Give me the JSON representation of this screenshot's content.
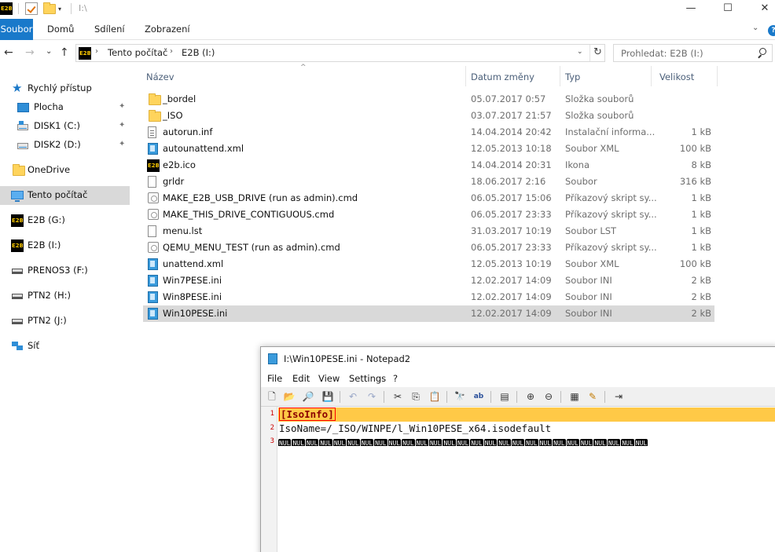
{
  "title": {
    "path": "I:\\",
    "minimize": "—",
    "maximize": "☐",
    "close": "✕",
    "qa_icon_text": "E2B"
  },
  "ribbon": {
    "tabs": [
      "Soubor",
      "Domů",
      "Sdílení",
      "Zobrazení"
    ],
    "help": "?",
    "chevron": "⌄"
  },
  "nav": {
    "back": "←",
    "forward": "→",
    "recent": "⌄",
    "up": "↑",
    "address_segments": [
      "Tento počítač",
      "E2B (I:)"
    ],
    "address_dropdown": "⌄",
    "refresh": "↻",
    "search_placeholder": "Prohledat: E2B (I:)"
  },
  "sidebar": {
    "items": [
      {
        "label": "Rychlý přístup",
        "icon": "star-icon"
      },
      {
        "label": "Plocha",
        "icon": "desktop-icon",
        "pinned": true
      },
      {
        "label": "DISK1 (C:)",
        "icon": "windows-drive-icon",
        "pinned": true
      },
      {
        "label": "DISK2 (D:)",
        "icon": "drive-icon",
        "pinned": true
      },
      {
        "label": "OneDrive",
        "icon": "folder-icon"
      },
      {
        "label": "Tento počítač",
        "icon": "computer-icon",
        "selected": true
      },
      {
        "label": "E2B (G:)",
        "icon": "e2b-icon"
      },
      {
        "label": "E2B (I:)",
        "icon": "e2b-icon"
      },
      {
        "label": "PRENOS3 (F:)",
        "icon": "usb-drive-icon"
      },
      {
        "label": "PTN2 (H:)",
        "icon": "usb-drive-icon"
      },
      {
        "label": "PTN2 (J:)",
        "icon": "usb-drive-icon"
      },
      {
        "label": "Síť",
        "icon": "network-icon"
      }
    ],
    "pin_glyph": "📌"
  },
  "files": {
    "columns": [
      "Název",
      "Datum změny",
      "Typ",
      "Velikost"
    ],
    "sort_glyph": "^",
    "rows": [
      {
        "name": "_bordel",
        "date": "05.07.2017 0:57",
        "type": "Složka souborů",
        "size": "",
        "icon": "folder-icon"
      },
      {
        "name": "_ISO",
        "date": "03.07.2017 21:57",
        "type": "Složka souborů",
        "size": "",
        "icon": "folder-icon"
      },
      {
        "name": "autorun.inf",
        "date": "14.04.2014 20:42",
        "type": "Instalační informa...",
        "size": "1 kB",
        "icon": "inf-file-icon"
      },
      {
        "name": "autounattend.xml",
        "date": "12.05.2013 10:18",
        "type": "Soubor XML",
        "size": "100 kB",
        "icon": "xml-file-icon"
      },
      {
        "name": "e2b.ico",
        "date": "14.04.2014 20:31",
        "type": "Ikona",
        "size": "8 kB",
        "icon": "e2b-icon"
      },
      {
        "name": "grldr",
        "date": "18.06.2017 2:16",
        "type": "Soubor",
        "size": "316 kB",
        "icon": "file-icon"
      },
      {
        "name": "MAKE_E2B_USB_DRIVE (run as admin).cmd",
        "date": "06.05.2017 15:06",
        "type": "Příkazový skript sy...",
        "size": "1 kB",
        "icon": "cmd-file-icon"
      },
      {
        "name": "MAKE_THIS_DRIVE_CONTIGUOUS.cmd",
        "date": "06.05.2017 23:33",
        "type": "Příkazový skript sy...",
        "size": "1 kB",
        "icon": "cmd-file-icon"
      },
      {
        "name": "menu.lst",
        "date": "31.03.2017 10:19",
        "type": "Soubor LST",
        "size": "1 kB",
        "icon": "file-icon"
      },
      {
        "name": "QEMU_MENU_TEST (run as admin).cmd",
        "date": "06.05.2017 23:33",
        "type": "Příkazový skript sy...",
        "size": "1 kB",
        "icon": "cmd-file-icon"
      },
      {
        "name": "unattend.xml",
        "date": "12.05.2013 10:19",
        "type": "Soubor XML",
        "size": "100 kB",
        "icon": "xml-file-icon"
      },
      {
        "name": "Win7PESE.ini",
        "date": "12.02.2017 14:09",
        "type": "Soubor INI",
        "size": "2 kB",
        "icon": "ini-file-icon"
      },
      {
        "name": "Win8PESE.ini",
        "date": "12.02.2017 14:09",
        "type": "Soubor INI",
        "size": "2 kB",
        "icon": "ini-file-icon"
      },
      {
        "name": "Win10PESE.ini",
        "date": "12.02.2017 14:09",
        "type": "Soubor INI",
        "size": "2 kB",
        "icon": "ini-file-icon",
        "selected": true
      }
    ]
  },
  "notepad": {
    "title": "I:\\Win10PESE.ini - Notepad2",
    "menu": [
      "File",
      "Edit",
      "View",
      "Settings",
      "?"
    ],
    "toolbar": [
      "new-icon",
      "open-icon",
      "browse-icon",
      "save-icon",
      "undo-icon",
      "redo-icon",
      "cut-icon",
      "copy-icon",
      "paste-icon",
      "find-icon",
      "replace-icon",
      "word-wrap-icon",
      "zoom-in-icon",
      "zoom-out-icon",
      "scheme-icon",
      "customize-icon",
      "exit-icon"
    ],
    "line_numbers": [
      "1",
      "2",
      "3"
    ],
    "line1_section": "[IsoInfo]",
    "line2": "IsoName=/_ISO/WINPE/l_Win10PESE_x64.isodefault",
    "nul_label": "NUL",
    "nul_count": 27,
    "current_line_color": "#ffc947"
  }
}
